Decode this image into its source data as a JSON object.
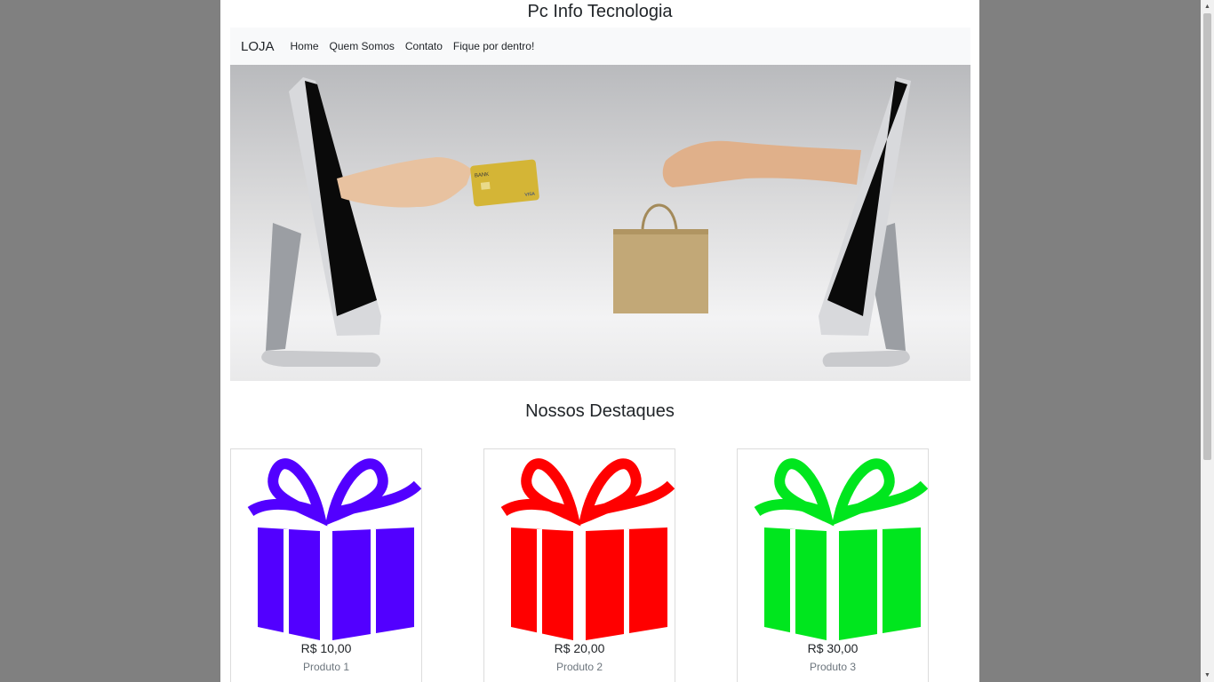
{
  "site": {
    "title": "Pc Info Tecnologia"
  },
  "navbar": {
    "brand": "LOJA",
    "links": [
      "Home",
      "Quem Somos",
      "Contato",
      "Fique por dentro!"
    ]
  },
  "hero": {
    "card_text": "BANK",
    "card_brand": "VISA"
  },
  "highlights": {
    "title": "Nossos Destaques",
    "products": [
      {
        "price": "R$ 10,00",
        "name": "Produto 1",
        "color": "#5200ff"
      },
      {
        "price": "R$ 20,00",
        "name": "Produto 2",
        "color": "#ff0000"
      },
      {
        "price": "R$ 30,00",
        "name": "Produto 3",
        "color": "#00e61e"
      }
    ]
  }
}
